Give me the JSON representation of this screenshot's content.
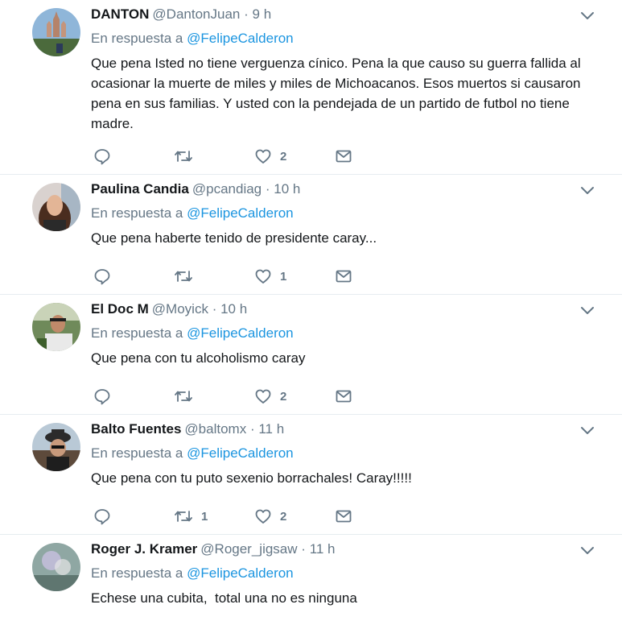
{
  "tweets": [
    {
      "name": "DANTON",
      "handle": "@DantonJuan",
      "separator": "·",
      "time": "9 h",
      "reply_prefix": "En respuesta a",
      "reply_to": "@FelipeCalderon",
      "text": "Que pena Isted no tiene verguenza cínico. Pena la que causo su guerra fallida al\nocasionar la muerte de miles y miles de Michoacanos. Esos muertos si causaron\npena en sus familias. Y usted con la pendejada de un partido de futbol no tiene\nmadre.",
      "replies": "",
      "retweets": "",
      "likes": "2"
    },
    {
      "name": "Paulina Candia",
      "handle": "@pcandiag",
      "separator": "·",
      "time": "10 h",
      "reply_prefix": "En respuesta a",
      "reply_to": "@FelipeCalderon",
      "text": "Que pena haberte tenido de presidente caray...",
      "replies": "",
      "retweets": "",
      "likes": "1"
    },
    {
      "name": "El Doc M",
      "handle": "@Moyick",
      "separator": "·",
      "time": "10 h",
      "reply_prefix": "En respuesta a",
      "reply_to": "@FelipeCalderon",
      "text": "Que pena con tu alcoholismo caray",
      "replies": "",
      "retweets": "",
      "likes": "2"
    },
    {
      "name": "Balto Fuentes",
      "handle": "@baltomx",
      "separator": "·",
      "time": "11 h",
      "reply_prefix": "En respuesta a",
      "reply_to": "@FelipeCalderon",
      "text": "Que pena con tu puto sexenio borrachales! Caray!!!!!",
      "replies": "",
      "retweets": "1",
      "likes": "2"
    },
    {
      "name": "Roger J. Kramer",
      "handle": "@Roger_jigsaw",
      "separator": "·",
      "time": "11 h",
      "reply_prefix": "En respuesta a",
      "reply_to": "@FelipeCalderon",
      "text": "Echese una cubita,  total una no es ninguna",
      "replies": "",
      "retweets": "",
      "likes": ""
    }
  ],
  "colors": {
    "text": "#14171a",
    "secondary": "#657786",
    "link": "#1b95e0",
    "divider": "#e6ecf0"
  },
  "icons": {
    "reply": "reply-icon",
    "retweet": "retweet-icon",
    "like": "heart-icon",
    "dm": "envelope-icon",
    "menu": "chevron-down-icon"
  }
}
